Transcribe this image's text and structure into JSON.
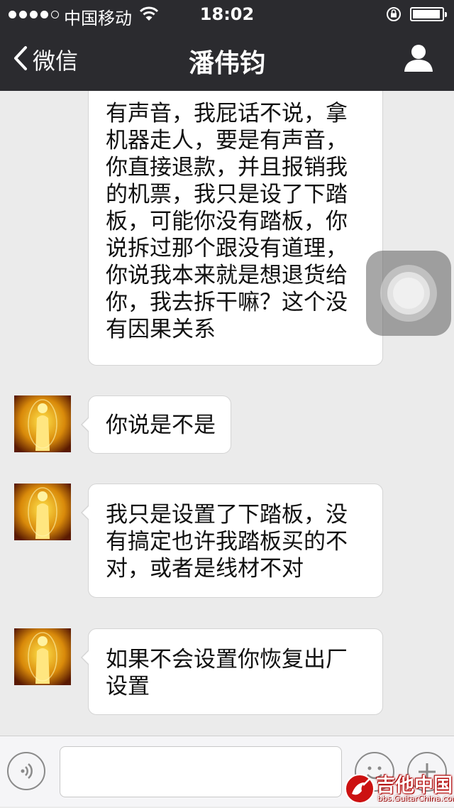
{
  "status_bar": {
    "carrier": "中国移动",
    "time": "18:02",
    "signal_bars": 4,
    "signal_total": 5
  },
  "nav": {
    "back_label": "微信",
    "title": "潘伟钧"
  },
  "messages": [
    {
      "sender": "contact",
      "avatar_visible": false,
      "text": "有声音，我屁话不说，拿\n机器走人，要是有声音，\n你直接退款，并且报销我\n的机票，我只是设了下踏\n板，可能你没有踏板，你\n说拆过那个跟没有道理，\n你说我本来就是想退货给\n你，我去拆干嘛？这个没\n有因果关系"
    },
    {
      "sender": "contact",
      "avatar_visible": true,
      "text": "你说是不是"
    },
    {
      "sender": "contact",
      "avatar_visible": true,
      "text": "我只是设置了下踏板，没\n有搞定也许我踏板买的不\n对，或者是线材不对"
    },
    {
      "sender": "contact",
      "avatar_visible": true,
      "text": "如果不会设置你恢复出厂\n设置"
    }
  ],
  "input": {
    "placeholder": ""
  },
  "watermark": {
    "title": "吉他中国",
    "url": "bbs.GuitarChina.com"
  },
  "colors": {
    "header_bg": "#2b2b2f",
    "chat_bg": "#ebebeb",
    "bubble_bg": "#ffffff",
    "watermark_red": "#cc1111"
  },
  "icons": {
    "back": "chevron-left-icon",
    "profile": "person-icon",
    "wifi": "wifi-icon",
    "orientation_lock": "rotation-lock-icon",
    "battery": "battery-icon",
    "voice": "voice-icon",
    "emoji": "emoji-icon",
    "plus": "plus-icon",
    "assistive_touch": "assistive-touch-icon"
  }
}
